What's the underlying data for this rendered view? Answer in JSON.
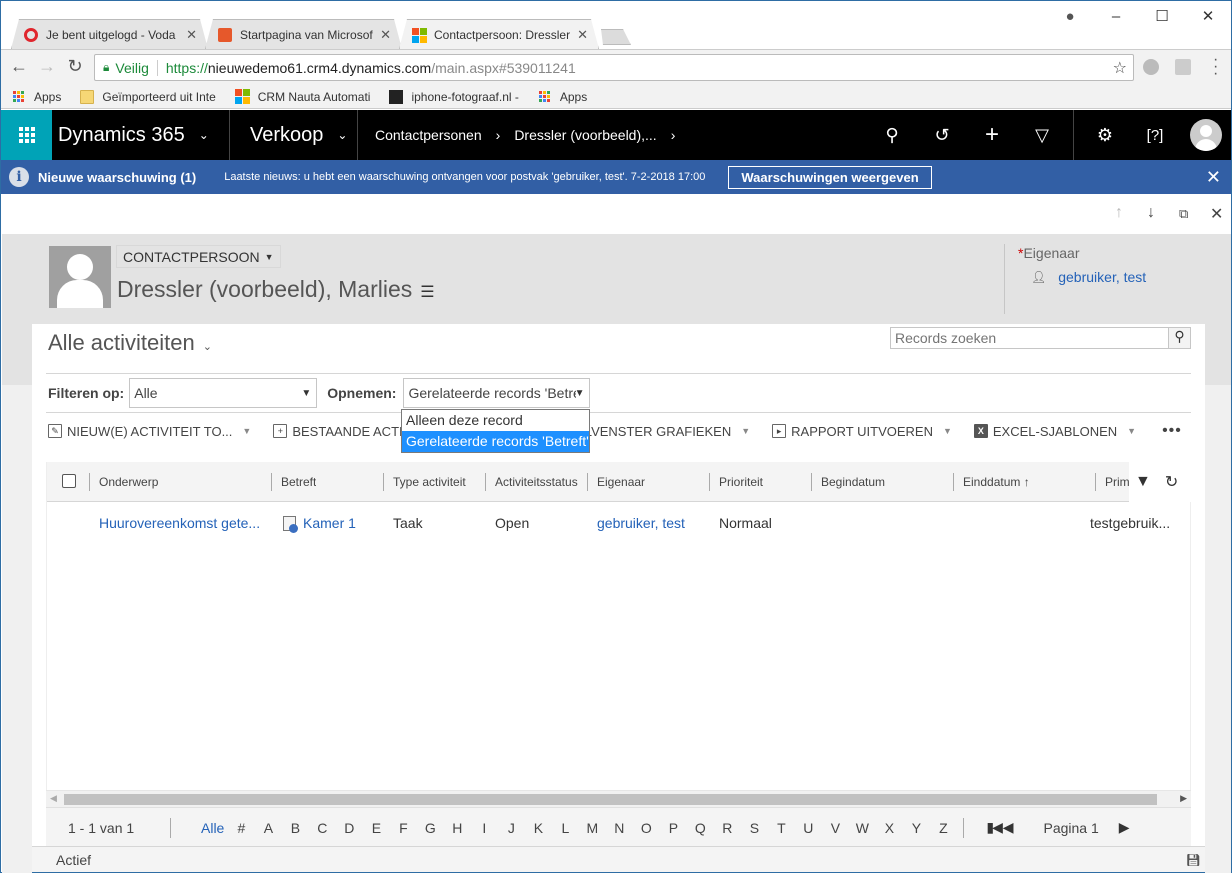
{
  "browser": {
    "tabs": [
      {
        "title": "Je bent uitgelogd - Voda",
        "icon": "opera-icon",
        "active": false
      },
      {
        "title": "Startpagina van Microsof",
        "icon": "office-icon",
        "active": false
      },
      {
        "title": "Contactpersoon: Dressler",
        "icon": "microsoft-icon",
        "active": true
      }
    ],
    "address": {
      "secure_label": "Veilig",
      "scheme": "https://",
      "host": "nieuwedemo61.crm4.dynamics.com",
      "path": "/main.aspx#539011241"
    },
    "bookmarks": [
      {
        "label": "Apps",
        "icon": "apps-icon"
      },
      {
        "label": "Geïmporteerd uit Inte",
        "icon": "folder-icon"
      },
      {
        "label": "CRM Nauta Automati",
        "icon": "microsoft-icon"
      },
      {
        "label": "iphone-fotograaf.nl -",
        "icon": "photo-icon"
      },
      {
        "label": "Apps",
        "icon": "apps-icon"
      }
    ]
  },
  "nav": {
    "app_name": "Dynamics 365",
    "area": "Verkoop",
    "breadcrumbs": [
      "Contactpersonen",
      "Dressler (voorbeeld),..."
    ],
    "icons": [
      "search-icon",
      "history-icon",
      "plus-icon",
      "filter-icon",
      "gear-icon",
      "help-icon",
      "user-avatar"
    ]
  },
  "notification": {
    "title": "Nieuwe waarschuwing (1)",
    "message": "Laatste nieuws: u hebt een waarschuwing ontvangen voor postvak 'gebruiker, test'. 7-2-2018 17:00",
    "button": "Waarschuwingen weergeven"
  },
  "record": {
    "entity": "CONTACTPERSOON",
    "name": "Dressler (voorbeeld), Marlies",
    "owner_label": "Eigenaar",
    "owner_required": "*",
    "owner_value": "gebruiker, test"
  },
  "view": {
    "title": "Alle activiteiten",
    "search_placeholder": "Records zoeken",
    "filter_label": "Filteren op:",
    "filter_value": "Alle",
    "include_label": "Opnemen:",
    "include_value": "Gerelateerde records 'Betref",
    "include_options": [
      {
        "label": "Alleen deze record",
        "selected": false
      },
      {
        "label": "Gerelateerde records 'Betreft'",
        "selected": true
      }
    ]
  },
  "commands": [
    {
      "label": "NIEUW(E) ACTIVITEIT TO...",
      "dropdown": true
    },
    {
      "label": "BESTAANDE ACTIVITEIT",
      "dropdown": false
    },
    {
      "label": "DEELVENSTER GRAFIEKEN",
      "dropdown": true
    },
    {
      "label": "RAPPORT UITVOEREN",
      "dropdown": true
    },
    {
      "label": "EXCEL-SJABLONEN",
      "dropdown": true
    }
  ],
  "grid": {
    "columns": [
      "Onderwerp",
      "Betreft",
      "Type activiteit",
      "Activiteitsstatus",
      "Eigenaar",
      "Prioriteit",
      "Begindatum",
      "Einddatum ↑",
      "Prim"
    ],
    "rows": [
      {
        "onderwerp": "Huurovereenkomst gete...",
        "betreft": "Kamer 1",
        "type": "Taak",
        "status": "Open",
        "eigenaar": "gebruiker, test",
        "prioriteit": "Normaal",
        "begindatum": "",
        "einddatum": "",
        "prim": "testgebruik..."
      }
    ]
  },
  "pager": {
    "count": "1 - 1 van 1",
    "letters": [
      "Alle",
      "#",
      "A",
      "B",
      "C",
      "D",
      "E",
      "F",
      "G",
      "H",
      "I",
      "J",
      "K",
      "L",
      "M",
      "N",
      "O",
      "P",
      "Q",
      "R",
      "S",
      "T",
      "U",
      "V",
      "W",
      "X",
      "Y",
      "Z"
    ],
    "page_label": "Pagina 1"
  },
  "status": {
    "text": "Actief"
  }
}
